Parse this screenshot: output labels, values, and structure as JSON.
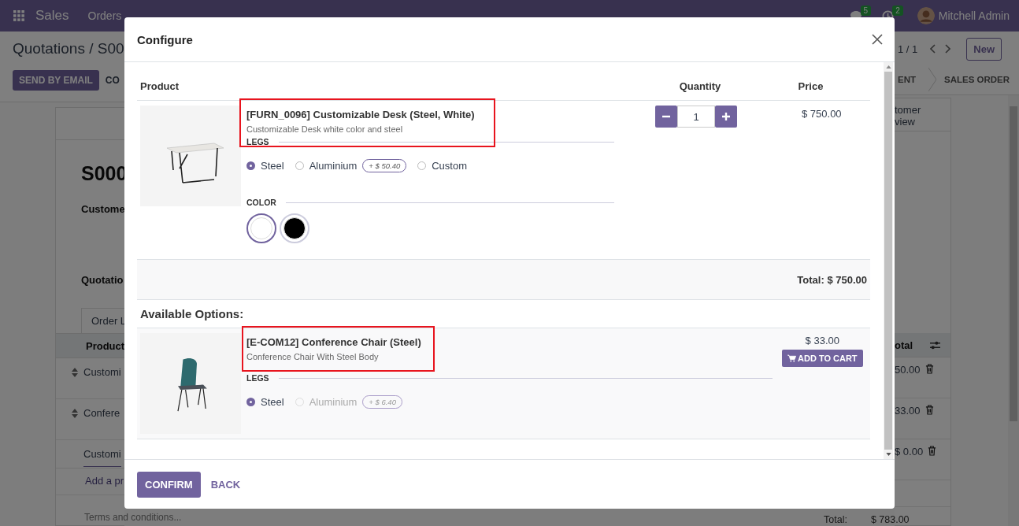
{
  "navbar": {
    "app": "Sales",
    "menus": [
      "Orders"
    ],
    "messages_count": "5",
    "activities_count": "2",
    "user": "Mitchell Admin"
  },
  "control_panel": {
    "breadcrumb": "Quotations / S00",
    "buttons": [
      "SEND BY EMAIL",
      "CO"
    ],
    "pager": "1 / 1",
    "new_button": "New",
    "stages": [
      "ENT",
      "SALES ORDER"
    ]
  },
  "form": {
    "name": "S000",
    "customer_label": "Custome",
    "quotation_label": "Quotatio",
    "tab": "Order L",
    "product_header": "Product",
    "subtotal_header": "otal",
    "smart_button": [
      "tomer",
      "view"
    ],
    "lines": [
      {
        "kind": "product",
        "product": "Customi",
        "subtotal": "50.00"
      },
      {
        "kind": "product",
        "product": "Confere",
        "subtotal": "33.00"
      },
      {
        "kind": "editing",
        "product": "Customi",
        "subtotal": "$ 0.00"
      }
    ],
    "add_line": "Add a pr",
    "terms_placeholder": "Terms and conditions...",
    "total_label": "Total:",
    "total": "$ 783.00"
  },
  "dialog": {
    "title": "Configure",
    "columns": [
      "Product",
      "Quantity",
      "Price"
    ],
    "product": {
      "name": "[FURN_0096] Customizable Desk (Steel, White)",
      "description": "Customizable Desk white color and steel",
      "highlighted": true,
      "quantity": "1",
      "price": "$ 750.00",
      "attributes": [
        {
          "kind": "radio",
          "name": "LEGS",
          "options": [
            {
              "label": "Steel",
              "selected": true,
              "disabled": false
            },
            {
              "label": "Aluminium",
              "selected": false,
              "disabled": false,
              "extra": "+ $ 50.40"
            },
            {
              "label": "Custom",
              "selected": false,
              "disabled": false
            }
          ]
        },
        {
          "kind": "color",
          "name": "COLOR",
          "options": [
            {
              "color": "#ffffff",
              "selected": true
            },
            {
              "color": "#000000",
              "selected": false
            }
          ]
        }
      ]
    },
    "total_label": "Total: $ 750.00",
    "options_title": "Available Options:",
    "optional_products": [
      {
        "name": "[E-COM12] Conference Chair (Steel)",
        "description": "Conference Chair With Steel Body",
        "highlighted": true,
        "price": "$ 33.00",
        "button": "ADD TO CART",
        "attributes": [
          {
            "kind": "radio",
            "name": "LEGS",
            "options": [
              {
                "label": "Steel",
                "selected": true,
                "disabled": false
              },
              {
                "label": "Aluminium",
                "selected": false,
                "disabled": true,
                "extra": "+ $ 6.40"
              }
            ]
          }
        ]
      }
    ],
    "confirm": "CONFIRM",
    "back": "BACK"
  }
}
